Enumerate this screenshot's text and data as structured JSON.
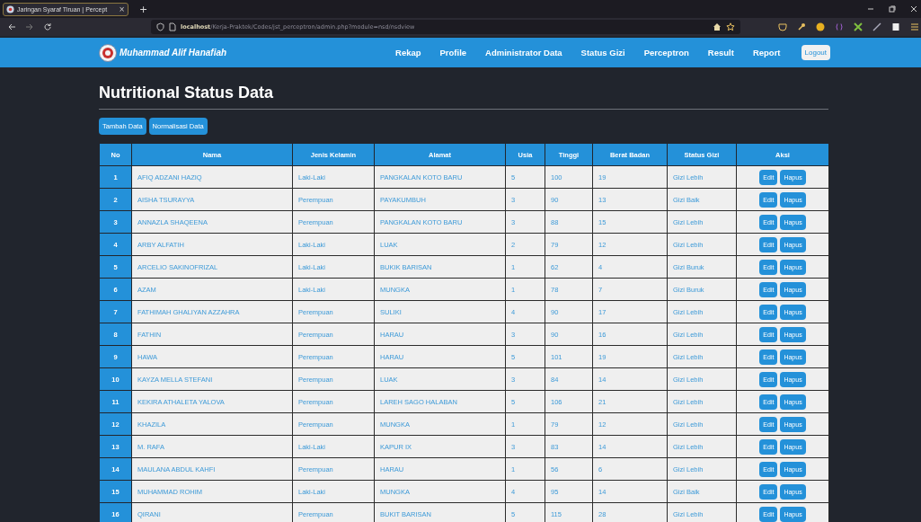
{
  "browser": {
    "tab_title": "Jaringan Syaraf Tiruan | Percept",
    "tab_close": "×",
    "new_tab": "+",
    "url_host": "localhost",
    "url_path": "/Kerja-Praktek/Codes/jst_perceptron/admin.php?module=nsd/nsdview"
  },
  "navbar": {
    "brand": "Muhammad Alif Hanafiah",
    "links": [
      "Rekap",
      "Profile",
      "Administrator Data",
      "Status Gizi",
      "Perceptron",
      "Result",
      "Report"
    ],
    "logout": "Logout"
  },
  "page_title": "Nutritional Status Data",
  "actions": [
    "Tambah Data",
    "Normalisasi Data"
  ],
  "table": {
    "columns": [
      "No",
      "Nama",
      "Jenis Kelamin",
      "Alamat",
      "Usia",
      "Tinggi",
      "Berat Badan",
      "Status Gizi",
      "Aksi"
    ],
    "rows": [
      {
        "cells": [
          "1",
          "AFIQ ADZANI HAZIQ",
          "Laki-Laki",
          "PANGKALAN KOTO BARU",
          "5",
          "100",
          "19",
          "Gizi Lebih"
        ],
        "buttons": [
          "Edit",
          "Hapus"
        ]
      },
      {
        "cells": [
          "2",
          "AISHA TSURAYYA",
          "Perempuan",
          "PAYAKUMBUH",
          "3",
          "90",
          "13",
          "Gizi Baik"
        ],
        "buttons": [
          "Edit",
          "Hapus"
        ]
      },
      {
        "cells": [
          "3",
          "ANNAZLA SHAQEENA",
          "Perempuan",
          "PANGKALAN KOTO BARU",
          "3",
          "88",
          "15",
          "Gizi Lebih"
        ],
        "buttons": [
          "Edit",
          "Hapus"
        ]
      },
      {
        "cells": [
          "4",
          "ARBY ALFATIH",
          "Laki-Laki",
          "LUAK",
          "2",
          "79",
          "12",
          "Gizi Lebih"
        ],
        "buttons": [
          "Edit",
          "Hapus"
        ]
      },
      {
        "cells": [
          "5",
          "ARCELIO SAKINOFRIZAL",
          "Laki-Laki",
          "BUKIK BARISAN",
          "1",
          "62",
          "4",
          "Gizi Buruk"
        ],
        "buttons": [
          "Edit",
          "Hapus"
        ]
      },
      {
        "cells": [
          "6",
          "AZAM",
          "Laki-Laki",
          "MUNGKA",
          "1",
          "78",
          "7",
          "Gizi Buruk"
        ],
        "buttons": [
          "Edit",
          "Hapus"
        ]
      },
      {
        "cells": [
          "7",
          "FATHIMAH GHALIYAN AZZAHRA",
          "Perempuan",
          "SULIKI",
          "4",
          "90",
          "17",
          "Gizi Lebih"
        ],
        "buttons": [
          "Edit",
          "Hapus"
        ]
      },
      {
        "cells": [
          "8",
          "FATHIN",
          "Perempuan",
          "HARAU",
          "3",
          "90",
          "16",
          "Gizi Lebih"
        ],
        "buttons": [
          "Edit",
          "Hapus"
        ]
      },
      {
        "cells": [
          "9",
          "HAWA",
          "Perempuan",
          "HARAU",
          "5",
          "101",
          "19",
          "Gizi Lebih"
        ],
        "buttons": [
          "Edit",
          "Hapus"
        ]
      },
      {
        "cells": [
          "10",
          "KAYZA MELLA STEFANI",
          "Perempuan",
          "LUAK",
          "3",
          "84",
          "14",
          "Gizi Lebih"
        ],
        "buttons": [
          "Edit",
          "Hapus"
        ]
      },
      {
        "cells": [
          "11",
          "KEKIRA ATHALETA YALOVA",
          "Perempuan",
          "LAREH SAGO HALABAN",
          "5",
          "106",
          "21",
          "Gizi Lebih"
        ],
        "buttons": [
          "Edit",
          "Hapus"
        ]
      },
      {
        "cells": [
          "12",
          "KHAZILA",
          "Perempuan",
          "MUNGKA",
          "1",
          "79",
          "12",
          "Gizi Lebih"
        ],
        "buttons": [
          "Edit",
          "Hapus"
        ]
      },
      {
        "cells": [
          "13",
          "M. RAFA",
          "Laki-Laki",
          "KAPUR IX",
          "3",
          "83",
          "14",
          "Gizi Lebih"
        ],
        "buttons": [
          "Edit",
          "Hapus"
        ]
      },
      {
        "cells": [
          "14",
          "MAULANA ABDUL KAHFI",
          "Perempuan",
          "HARAU",
          "1",
          "56",
          "6",
          "Gizi Lebih"
        ],
        "buttons": [
          "Edit",
          "Hapus"
        ]
      },
      {
        "cells": [
          "15",
          "MUHAMMAD ROHIM",
          "Laki-Laki",
          "MUNGKA",
          "4",
          "95",
          "14",
          "Gizi Baik"
        ],
        "buttons": [
          "Edit",
          "Hapus"
        ]
      },
      {
        "cells": [
          "16",
          "QIRANI",
          "Perempuan",
          "BUKIT BARISAN",
          "5",
          "115",
          "28",
          "Gizi Lebih"
        ],
        "buttons": [
          "Edit",
          "Hapus"
        ]
      }
    ]
  }
}
